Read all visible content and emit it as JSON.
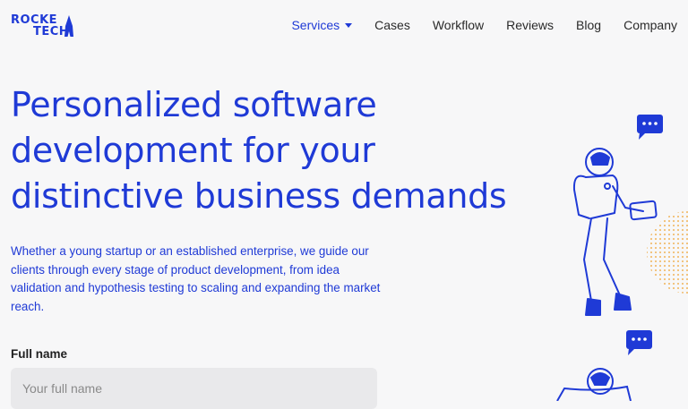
{
  "brand": {
    "line1": "ROCKE",
    "line2": "TECH",
    "color": "#1f3ad6"
  },
  "nav": {
    "items": [
      {
        "label": "Services",
        "active": true,
        "has_dropdown": true
      },
      {
        "label": "Cases"
      },
      {
        "label": "Workflow"
      },
      {
        "label": "Reviews"
      },
      {
        "label": "Blog"
      },
      {
        "label": "Company"
      }
    ]
  },
  "hero": {
    "title_lines": [
      "Personalized software",
      "development for your",
      "distinctive business demands"
    ],
    "description": "Whether a young startup or an established enterprise, we guide our clients through every stage of product development, from idea validation and hypothesis testing to scaling and expanding the market reach."
  },
  "form": {
    "full_name_label": "Full name",
    "full_name_placeholder": "Your full name",
    "full_name_value": ""
  },
  "icons": {
    "chat_bubble_1": "chat-bubble-icon",
    "chat_bubble_2": "chat-bubble-icon",
    "accent_dots": "#f0b35a"
  }
}
